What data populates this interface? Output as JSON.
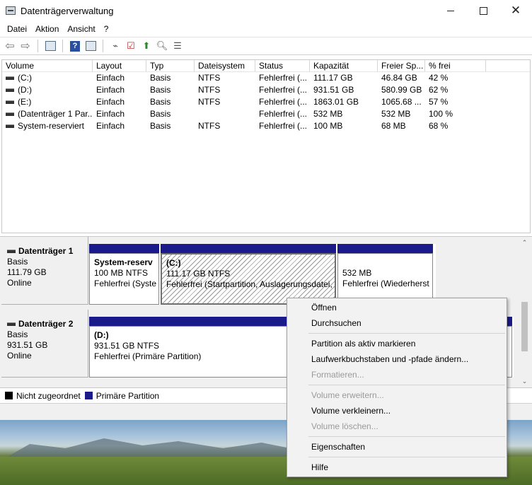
{
  "window": {
    "title": "Datenträgerverwaltung"
  },
  "menu": [
    "Datei",
    "Aktion",
    "Ansicht",
    "?"
  ],
  "toolbar_icons": [
    "back-arrow-icon",
    "forward-arrow-icon",
    "console-tree-icon",
    "help-icon",
    "properties-icon",
    "connect-icon",
    "check-icon",
    "up-icon",
    "search-icon",
    "list-icon"
  ],
  "volume_list": {
    "columns": [
      "Volume",
      "Layout",
      "Typ",
      "Dateisystem",
      "Status",
      "Kapazität",
      "Freier Sp...",
      "% frei"
    ],
    "rows": [
      [
        "(C:)",
        "Einfach",
        "Basis",
        "NTFS",
        "Fehlerfrei (...",
        "111.17 GB",
        "46.84 GB",
        "42 %"
      ],
      [
        "(D:)",
        "Einfach",
        "Basis",
        "NTFS",
        "Fehlerfrei (...",
        "931.51 GB",
        "580.99 GB",
        "62 %"
      ],
      [
        "(E:)",
        "Einfach",
        "Basis",
        "NTFS",
        "Fehlerfrei (...",
        "1863.01 GB",
        "1065.68 ...",
        "57 %"
      ],
      [
        "(Datenträger 1 Par...",
        "Einfach",
        "Basis",
        "",
        "Fehlerfrei (...",
        "532 MB",
        "532 MB",
        "100 %"
      ],
      [
        "System-reserviert",
        "Einfach",
        "Basis",
        "NTFS",
        "Fehlerfrei (...",
        "100 MB",
        "68 MB",
        "68 %"
      ]
    ]
  },
  "disks": [
    {
      "name": "Datenträger 1",
      "type": "Basis",
      "size": "111.79 GB",
      "state": "Online",
      "partitions": [
        {
          "title": "System-reserv",
          "line1": "100 MB NTFS",
          "line2": "Fehlerfrei (Syste"
        },
        {
          "title": "(C:)",
          "line1": "111.17 GB NTFS",
          "line2": "Fehlerfrei (Startpartition, Auslagerungsdatei,"
        },
        {
          "title": "",
          "line1": "532 MB",
          "line2": "Fehlerfrei (Wiederherst"
        }
      ]
    },
    {
      "name": "Datenträger 2",
      "type": "Basis",
      "size": "931.51 GB",
      "state": "Online",
      "partitions": [
        {
          "title": "(D:)",
          "line1": "931.51 GB NTFS",
          "line2": "Fehlerfrei (Primäre Partition)"
        }
      ]
    }
  ],
  "legend": {
    "unallocated": "Nicht zugeordnet",
    "primary": "Primäre Partition"
  },
  "context_menu": {
    "items": [
      {
        "label": "Öffnen",
        "enabled": true
      },
      {
        "label": "Durchsuchen",
        "enabled": true
      },
      {
        "label": "Partition als aktiv markieren",
        "enabled": true
      },
      {
        "label": "Laufwerkbuchstaben und -pfade ändern...",
        "enabled": true
      },
      {
        "label": "Formatieren...",
        "enabled": false
      },
      {
        "label": "Volume erweitern...",
        "enabled": false
      },
      {
        "label": "Volume verkleinern...",
        "enabled": true
      },
      {
        "label": "Volume löschen...",
        "enabled": false
      },
      {
        "label": "Eigenschaften",
        "enabled": true
      },
      {
        "label": "Hilfe",
        "enabled": true
      }
    ]
  },
  "colors": {
    "primary_partition": "#1a1a8a",
    "unallocated": "#000000"
  }
}
